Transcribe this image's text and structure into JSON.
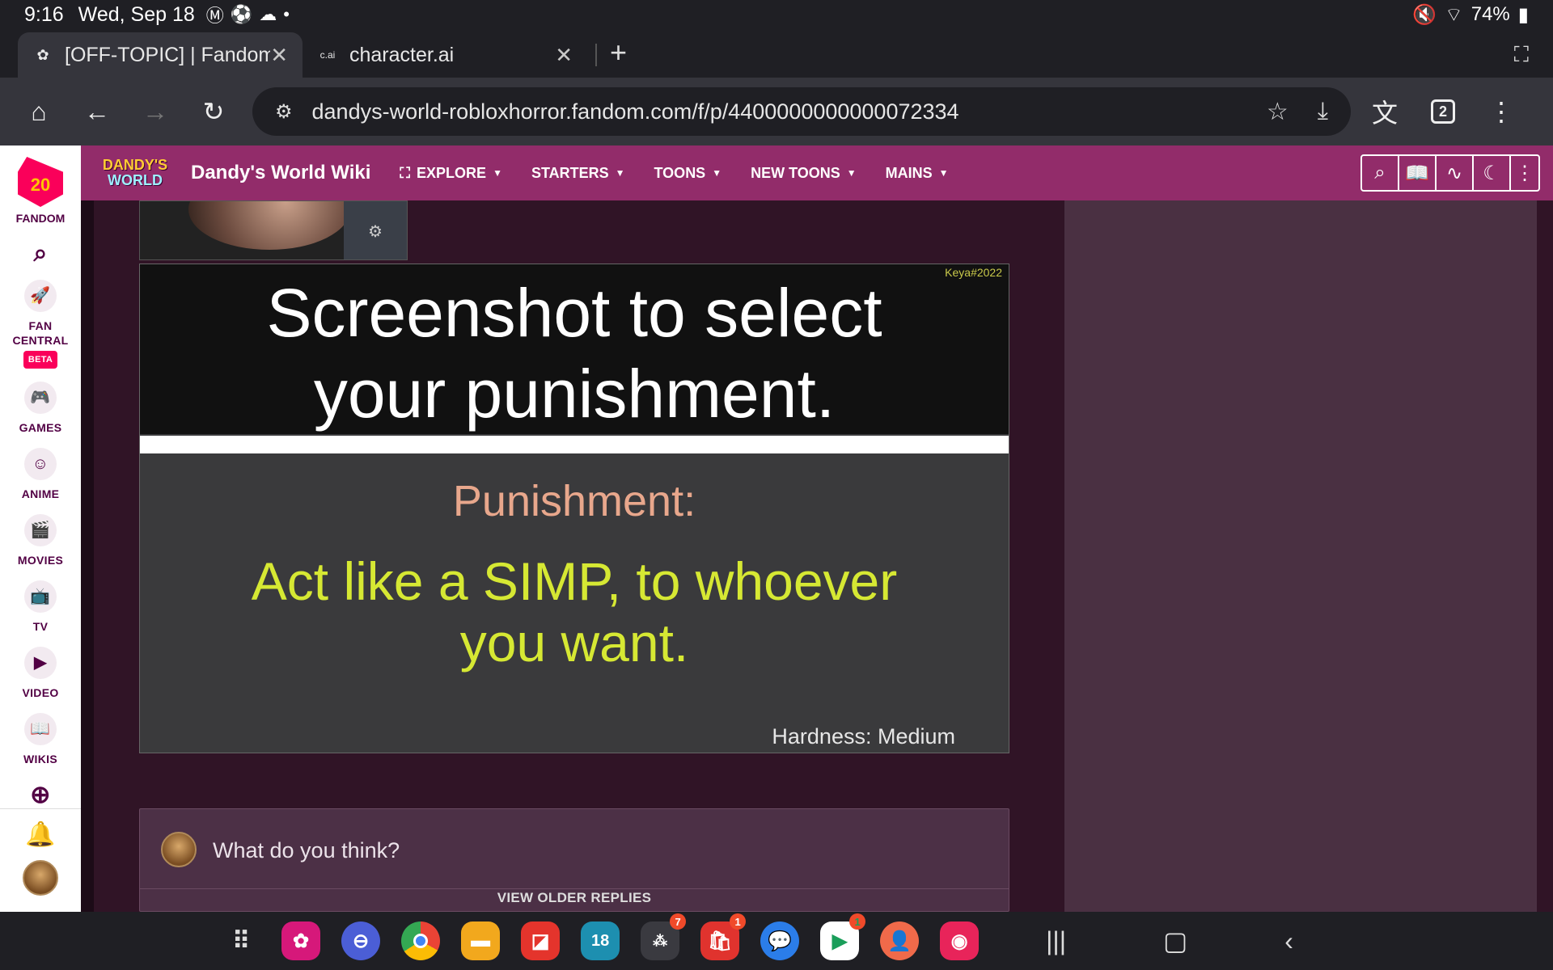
{
  "status_bar": {
    "time": "9:16",
    "date": "Wed, Sep 18",
    "battery": "74%"
  },
  "tabs": [
    {
      "title": "[OFF-TOPIC] | Fandom",
      "favicon": "fandom-flower-icon",
      "active": true
    },
    {
      "title": "character.ai",
      "favicon_text": "c.ai",
      "active": false
    }
  ],
  "toolbar": {
    "url": "dandys-world-robloxhorror.fandom.com/f/p/4400000000000072334",
    "tab_count": "2"
  },
  "fandom_rail": {
    "logo_text": "20",
    "fandom_label": "FANDOM",
    "items": [
      {
        "label": "FAN CENTRAL",
        "icon": "rocket-icon"
      },
      {
        "label": "GAMES",
        "icon": "gamepad-icon"
      },
      {
        "label": "ANIME",
        "icon": "anime-face-icon"
      },
      {
        "label": "MOVIES",
        "icon": "clapperboard-icon"
      },
      {
        "label": "TV",
        "icon": "tv-icon"
      },
      {
        "label": "VIDEO",
        "icon": "play-icon"
      },
      {
        "label": "WIKIS",
        "icon": "book-icon"
      }
    ],
    "beta_label": "BETA"
  },
  "wiki_header": {
    "logo_line1": "DANDY'S",
    "logo_line2": "WORLD",
    "wiki_name": "Dandy's World Wiki",
    "nav": [
      "EXPLORE",
      "STARTERS",
      "TOONS",
      "NEW TOONS",
      "MAINS"
    ]
  },
  "meme": {
    "top_line1": "Screenshot to select",
    "top_line2": "your punishment.",
    "watermark": "Keya#2022",
    "punishment_label": "Punishment:",
    "punishment_text": "Act like a SIMP, to whoever you want.",
    "hardness": "Hardness: Medium"
  },
  "reply": {
    "placeholder": "What do you think?",
    "view_older": "VIEW OLDER REPLIES"
  },
  "dock": {
    "badges": {
      "apps_folder": "7",
      "store": "1",
      "play": "1"
    },
    "calendar_day": "18"
  },
  "colors": {
    "fandom_header": "#922c6a",
    "page_bg": "#301426",
    "right_col": "#4a3042",
    "punishment_label": "#e8a78c",
    "punishment_text": "#d6e833"
  }
}
